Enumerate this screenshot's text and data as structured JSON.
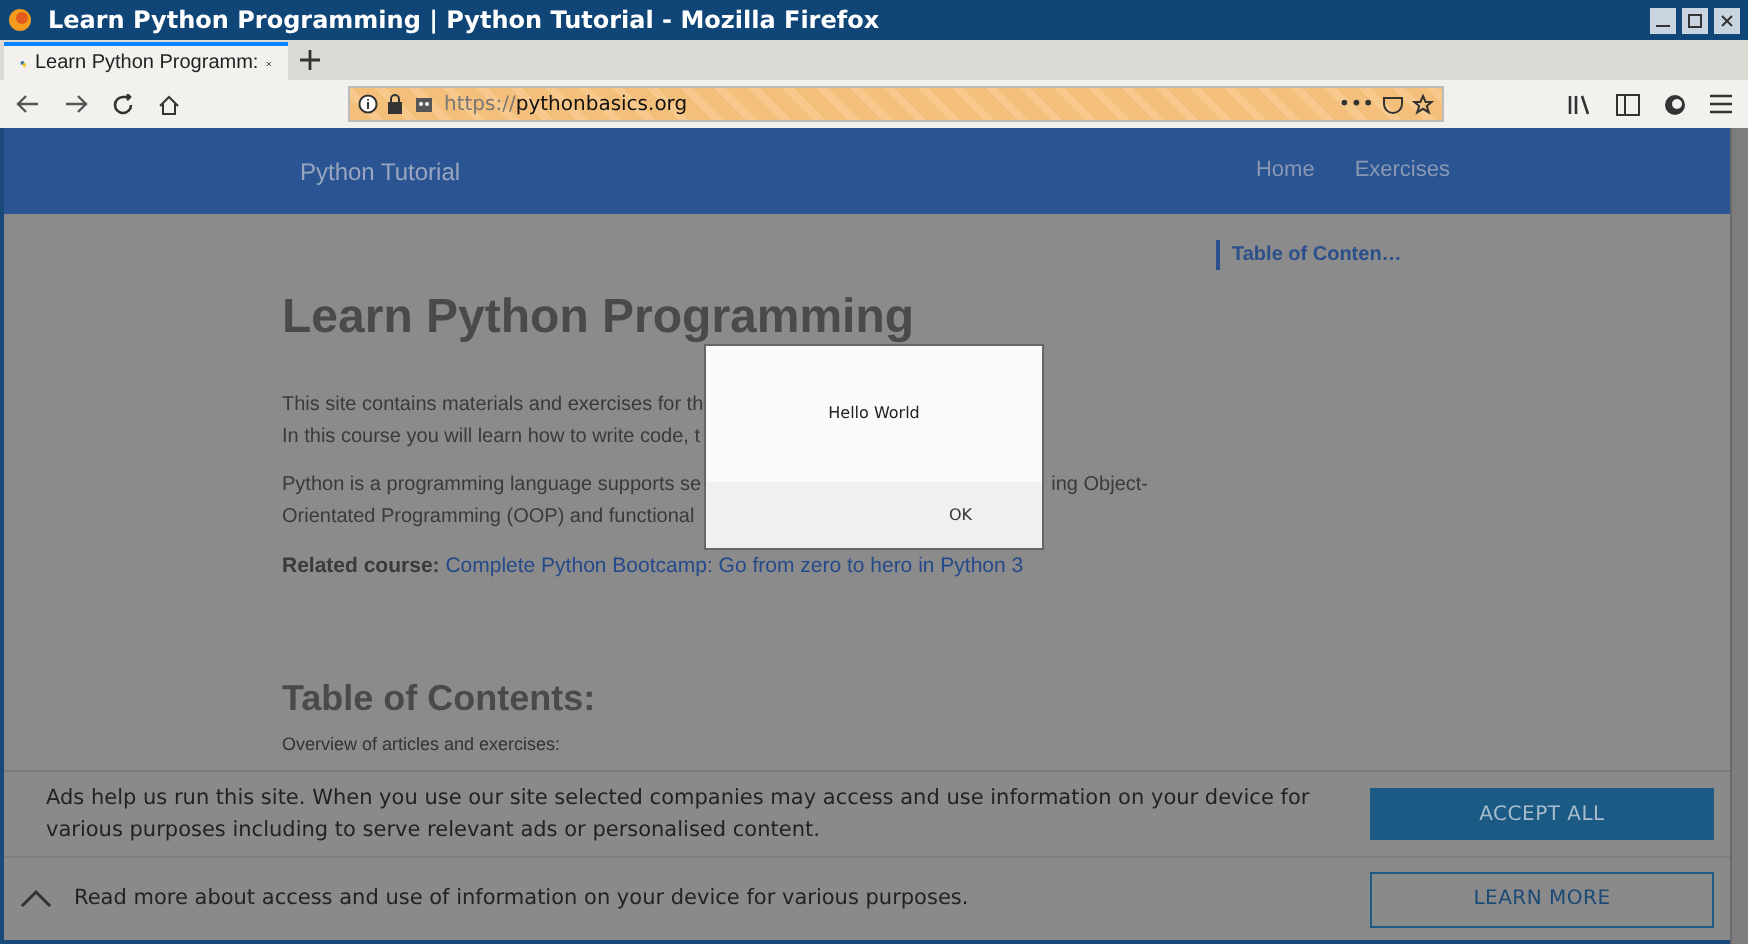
{
  "window": {
    "title": "Learn Python Programming | Python Tutorial - Mozilla Firefox"
  },
  "tabs": [
    {
      "label": "Learn Python Programm:",
      "selected": true
    }
  ],
  "address_bar": {
    "scheme": "https://",
    "host": "pythonbasics.org",
    "more": "•••"
  },
  "site_header": {
    "brand": "Python Tutorial",
    "nav": [
      "Home",
      "Exercises"
    ]
  },
  "page": {
    "title": "Learn Python Programming",
    "paragraph_1": [
      "This site contains materials and exercises for th",
      "In this course you will learn how to write code, t"
    ],
    "paragraph_2_left": "Python is a programming language supports se",
    "paragraph_2_right": "ing Object-",
    "paragraph_2_line_2": "Orientated Programming (OOP) and functional",
    "related_label": "Related course:",
    "related_link": "Complete Python Bootcamp: Go from zero to hero in Python 3",
    "toc_heading": "Table of Contents:",
    "overview": "Overview of articles and exercises:",
    "toc_link": "Table of Conten…"
  },
  "alert": {
    "message": "Hello World",
    "button": "OK"
  },
  "consent": {
    "text": "Ads help us run this site. When you use our site selected companies may access and use information on your device for various purposes including to serve relevant ads or personalised content.",
    "details": "Read more about access and use of information on your device for various purposes.",
    "accept": "ACCEPT ALL",
    "learn": "LEARN MORE"
  }
}
